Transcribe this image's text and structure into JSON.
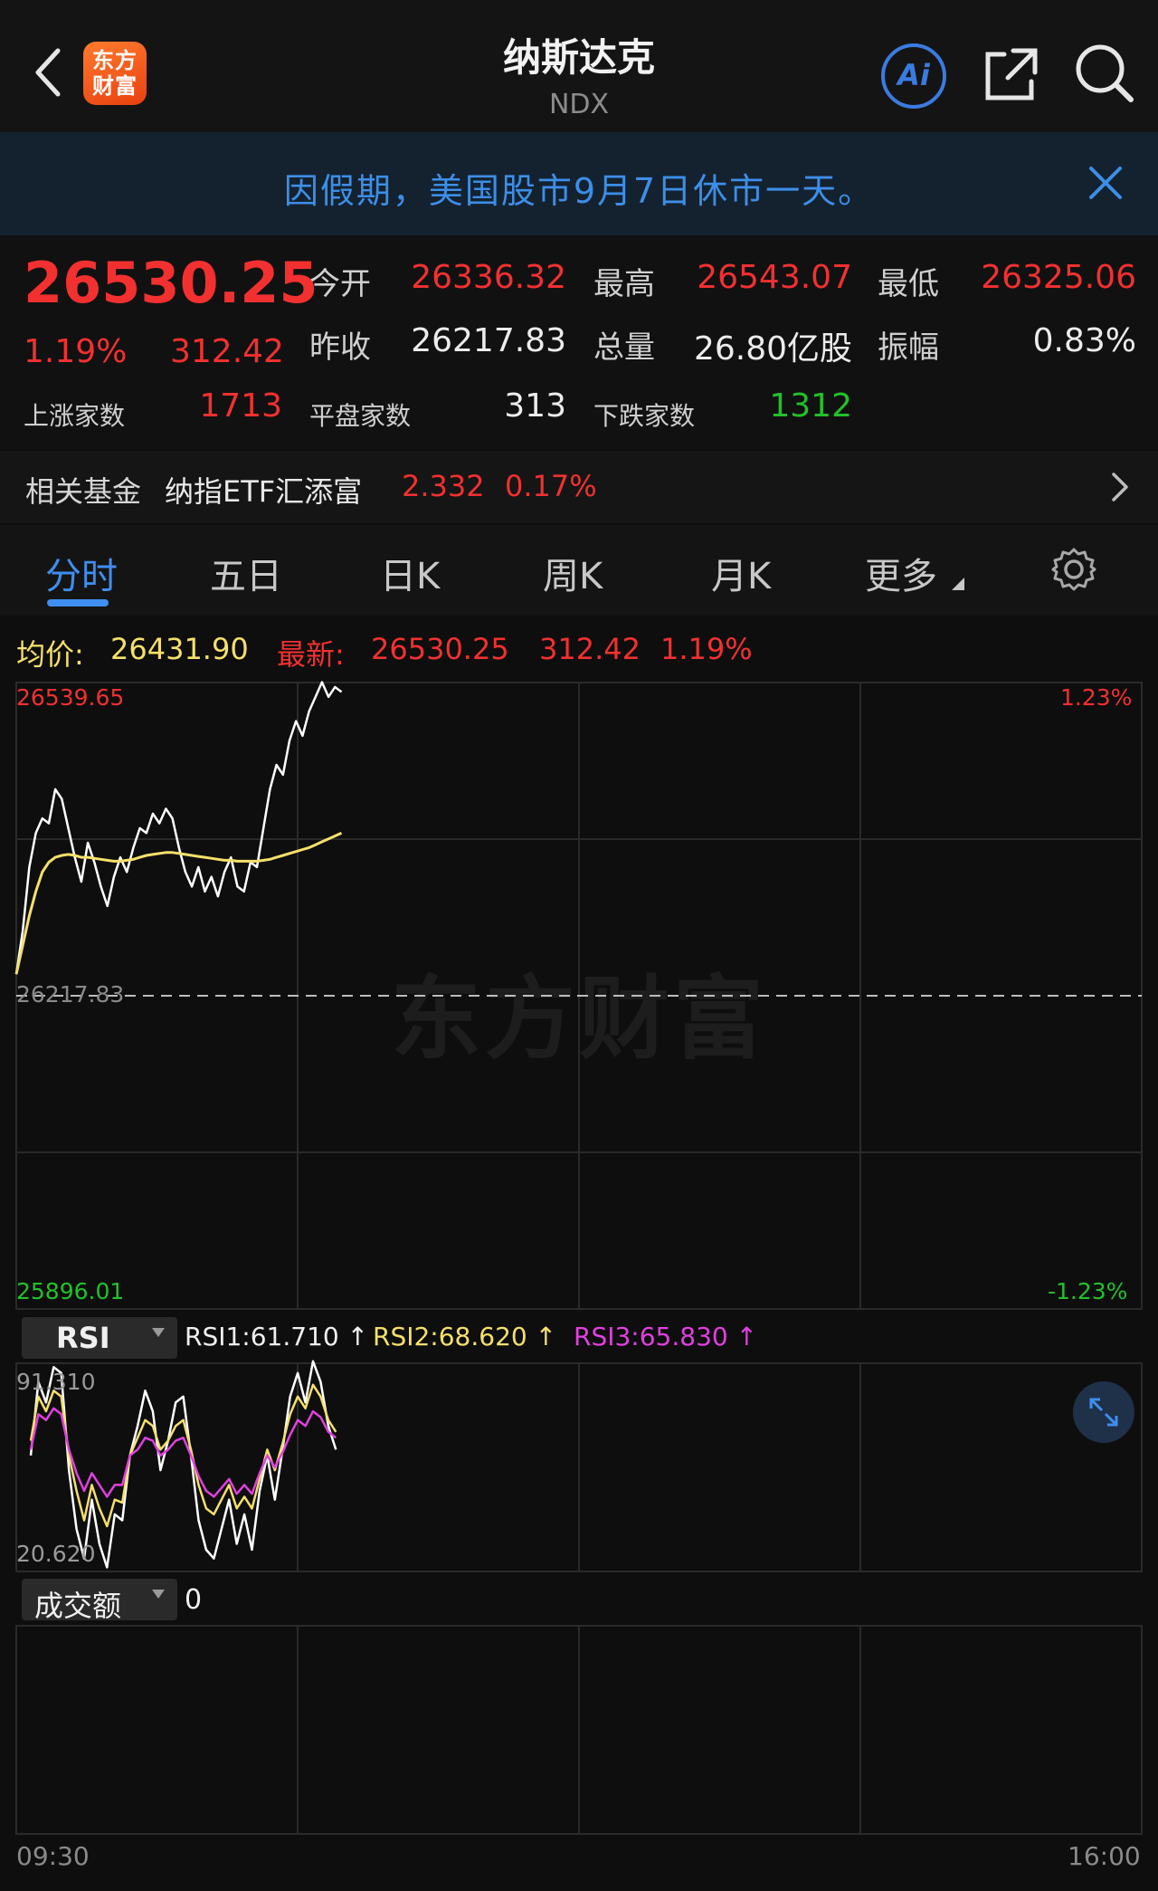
{
  "header": {
    "logo_text_line1": "东方",
    "logo_text_line2": "财富",
    "title": "纳斯达克",
    "subtitle": "NDX",
    "ai_label": "Ai"
  },
  "notice": {
    "text": "因假期，美国股市9月7日休市一天。"
  },
  "quote": {
    "price": "26530.25",
    "change_pct": "1.19%",
    "change_val": "312.42",
    "open_label": "今开",
    "open": "26336.32",
    "high_label": "最高",
    "high": "26543.07",
    "low_label": "最低",
    "low": "26325.06",
    "prev_close_label": "昨收",
    "prev_close": "26217.83",
    "volume_label": "总量",
    "volume": "26.80亿股",
    "amplitude_label": "振幅",
    "amplitude": "0.83%",
    "up_label": "上涨家数",
    "up_count": "1713",
    "flat_label": "平盘家数",
    "flat_count": "313",
    "down_label": "下跌家数",
    "down_count": "1312"
  },
  "fund": {
    "label": "相关基金",
    "name": "纳指ETF汇添富",
    "price": "2.332",
    "pct": "0.17%"
  },
  "tabs": [
    {
      "label": "分时",
      "active": true
    },
    {
      "label": "五日"
    },
    {
      "label": "日K"
    },
    {
      "label": "周K"
    },
    {
      "label": "月K"
    },
    {
      "label": "更多"
    }
  ],
  "legend": {
    "avg_label": "均价:",
    "avg_value": "26431.90",
    "latest_label": "最新:",
    "latest_value": "26530.25",
    "latest_change": "312.42",
    "latest_pct": "1.19%"
  },
  "watermark": "东方财富",
  "colors": {
    "up": "#f23030",
    "down": "#22c12a",
    "accent": "#3f8ef0",
    "avg_line": "#f5e06a",
    "rsi3": "#e040e0"
  },
  "chart_data": [
    {
      "type": "line",
      "title": "",
      "ylim": [
        25896.01,
        26539.65
      ],
      "y_right_range_pct": [
        "-1.23%",
        "1.23%"
      ],
      "reference_line": 26217.83,
      "y_max_label": "26539.65",
      "y_min_label": "25896.01",
      "ref_label": "26217.83",
      "pct_max_label": "1.23%",
      "pct_min_label": "-1.23%",
      "x_start_label": "09:30",
      "x_end_label": "16:00",
      "x": [
        0,
        0.02,
        0.04,
        0.06,
        0.08,
        0.1,
        0.12,
        0.14,
        0.16,
        0.18,
        0.2,
        0.22,
        0.24,
        0.26,
        0.28,
        0.3,
        0.32,
        0.34,
        0.36,
        0.38,
        0.4,
        0.42,
        0.44,
        0.46,
        0.48,
        0.5,
        0.52,
        0.54,
        0.56,
        0.58,
        0.6,
        0.62,
        0.64,
        0.66,
        0.68,
        0.7,
        0.72,
        0.74,
        0.76,
        0.78,
        0.8,
        0.82,
        0.84,
        0.86,
        0.88,
        0.9,
        0.92,
        0.94,
        0.96,
        0.98,
        1.0
      ],
      "series": [
        {
          "values": [
            26240,
            26285,
            26350,
            26385,
            26400,
            26395,
            26430,
            26420,
            26390,
            26360,
            26335,
            26375,
            26355,
            26330,
            26310,
            26340,
            26360,
            26345,
            26370,
            26390,
            26385,
            26405,
            26395,
            26410,
            26400,
            26370,
            26345,
            26330,
            26350,
            26325,
            26340,
            26320,
            26345,
            26360,
            26330,
            26325,
            26355,
            26350,
            26390,
            26430,
            26455,
            26445,
            26480,
            26500,
            26485,
            26510,
            26525,
            26540,
            26525,
            26535,
            26530
          ]
        },
        {
          "values": [
            26240,
            26270,
            26300,
            26325,
            26345,
            26355,
            26360,
            26362,
            26363,
            26362,
            26360,
            26360,
            26359,
            26358,
            26357,
            26356,
            26356,
            26357,
            26358,
            26360,
            26362,
            26363,
            26364,
            26365,
            26365,
            26364,
            26363,
            26362,
            26361,
            26360,
            26359,
            26358,
            26357,
            26357,
            26356,
            26356,
            26356,
            26356,
            26357,
            26358,
            26360,
            26362,
            26364,
            26366,
            26368,
            26370,
            26373,
            26376,
            26379,
            26382,
            26385
          ]
        }
      ]
    },
    {
      "type": "line",
      "title": "RSI",
      "ylim": [
        20.62,
        91.31
      ],
      "y_max_label": "91.310",
      "y_min_label": "20.620",
      "series": [
        {
          "name": "RSI1",
          "current": "61.710",
          "values": [
            60,
            85,
            78,
            90,
            88,
            55,
            35,
            25,
            45,
            30,
            22,
            40,
            38,
            60,
            70,
            82,
            75,
            55,
            65,
            78,
            80,
            60,
            38,
            28,
            25,
            35,
            45,
            30,
            40,
            28,
            48,
            60,
            45,
            62,
            80,
            88,
            78,
            92,
            85,
            70,
            62
          ]
        },
        {
          "name": "RSI2",
          "current": "68.620",
          "values": [
            65,
            80,
            75,
            82,
            80,
            60,
            48,
            38,
            50,
            42,
            36,
            45,
            44,
            60,
            66,
            72,
            70,
            62,
            65,
            70,
            72,
            62,
            50,
            42,
            40,
            45,
            50,
            42,
            46,
            42,
            52,
            62,
            55,
            64,
            74,
            80,
            76,
            84,
            80,
            72,
            68
          ]
        },
        {
          "name": "RSI3",
          "current": "65.830",
          "values": [
            62,
            74,
            72,
            76,
            74,
            62,
            54,
            48,
            54,
            50,
            46,
            50,
            50,
            60,
            62,
            66,
            65,
            60,
            62,
            65,
            66,
            60,
            53,
            48,
            46,
            49,
            52,
            47,
            50,
            47,
            54,
            60,
            56,
            61,
            67,
            72,
            70,
            75,
            73,
            68,
            66
          ]
        }
      ]
    }
  ],
  "rsi": {
    "selector": "RSI",
    "rsi1": "RSI1:61.710 ↑",
    "rsi2": "RSI2:68.620 ↑",
    "rsi3": "RSI3:65.830 ↑"
  },
  "volume": {
    "selector": "成交额",
    "value": "0"
  }
}
